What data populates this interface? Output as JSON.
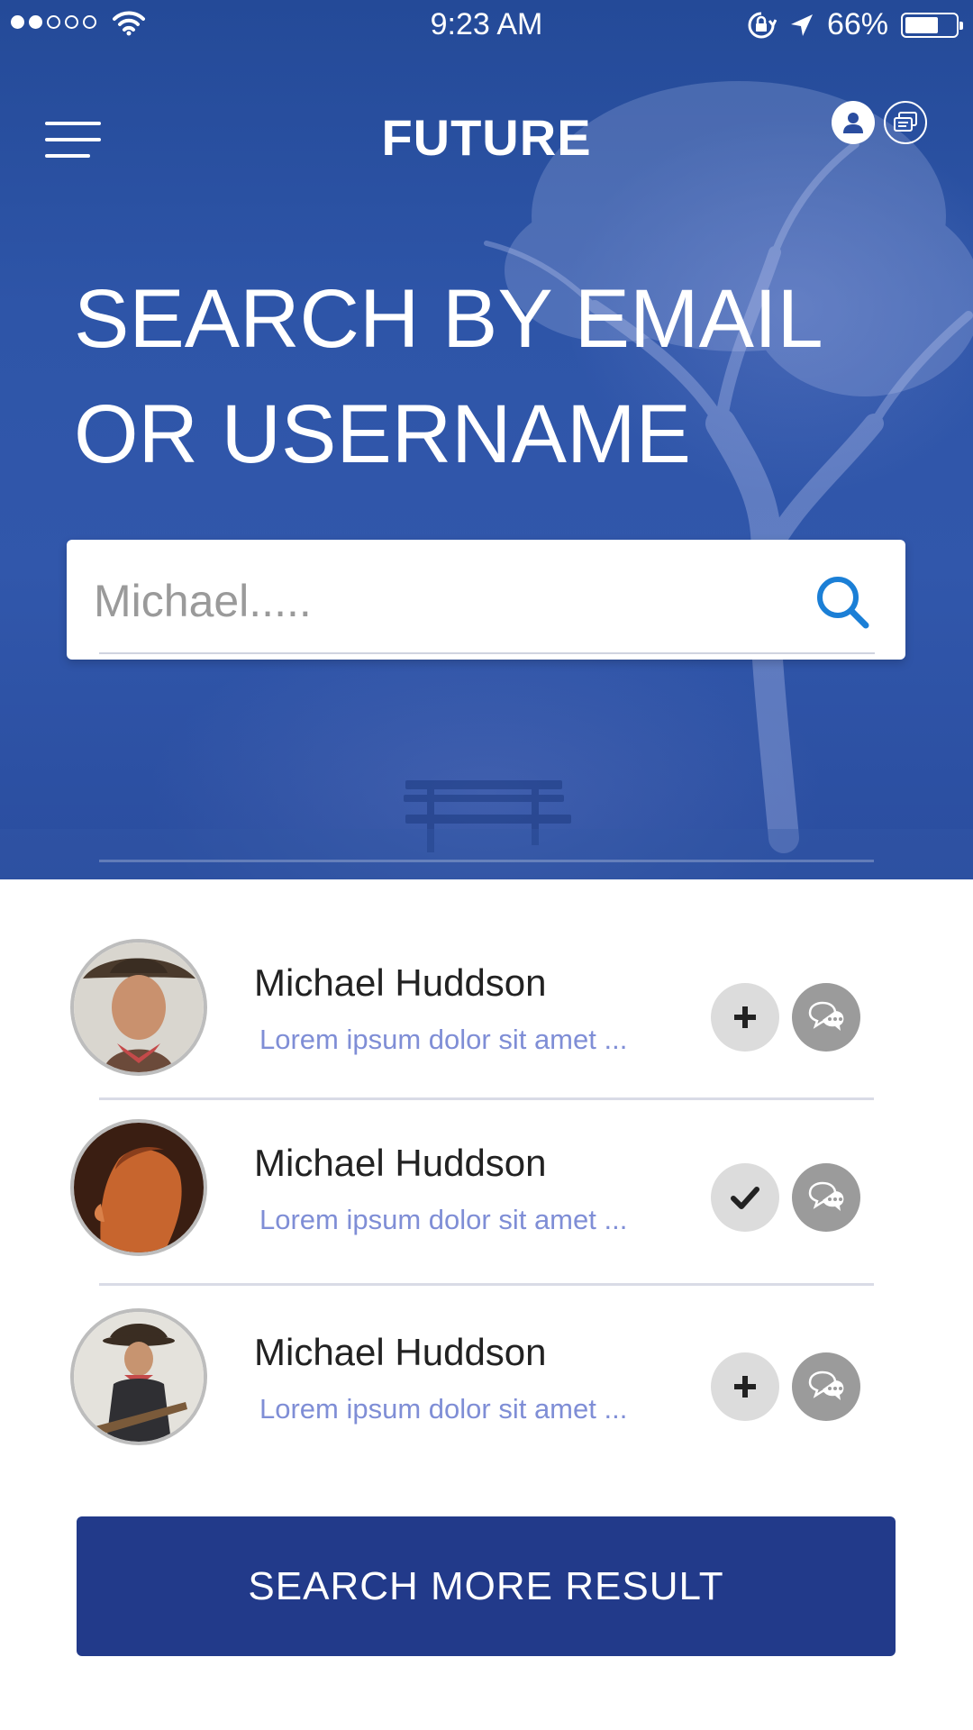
{
  "status_bar": {
    "time": "9:23 AM",
    "battery_percent": "66%",
    "battery_level": 0.66,
    "signal_bars_filled": 2,
    "signal_bars_total": 5
  },
  "header": {
    "title": "FUTURE",
    "menu_icon": "hamburger-menu-icon",
    "profile_icon": "user-icon",
    "messages_icon": "messages-icon"
  },
  "hero": {
    "headline_line1": "SEARCH BY EMAIL",
    "headline_line2": "OR USERNAME"
  },
  "search": {
    "placeholder": "Michael.....",
    "value": "",
    "icon": "search-icon",
    "icon_color": "#1b7fd6"
  },
  "results": [
    {
      "name": "Michael Huddson",
      "description": "Lorem ipsum dolor sit amet ...",
      "action": "add",
      "action_icon": "plus-icon",
      "chat_icon": "chat-bubbles-icon"
    },
    {
      "name": "Michael Huddson",
      "description": "Lorem ipsum dolor sit amet ...",
      "action": "added",
      "action_icon": "check-icon",
      "chat_icon": "chat-bubbles-icon"
    },
    {
      "name": "Michael Huddson",
      "description": "Lorem ipsum dolor sit amet ...",
      "action": "add",
      "action_icon": "plus-icon",
      "chat_icon": "chat-bubbles-icon"
    }
  ],
  "more_button": {
    "label": "SEARCH MORE RESULT"
  },
  "colors": {
    "hero_blue": "#2e55a8",
    "button_navy": "#223a8a",
    "description_text": "#7f8ed6",
    "search_icon": "#1b7fd6"
  }
}
